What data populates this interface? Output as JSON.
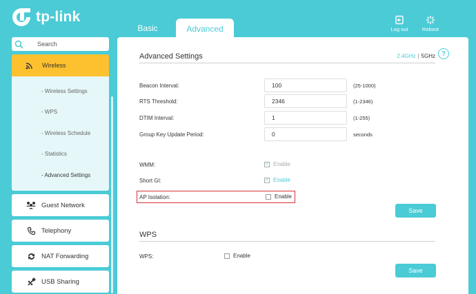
{
  "header": {
    "brand": "tp-link",
    "tabs": [
      {
        "label": "Basic",
        "active": false
      },
      {
        "label": "Advanced",
        "active": true
      }
    ],
    "logout_label": "Log out",
    "reboot_label": "Reboot"
  },
  "sidebar": {
    "search_placeholder": "Search",
    "active_item": {
      "label": "Wireless",
      "icon": "wifi-icon"
    },
    "sub_items": [
      {
        "label": "- Wireless Settings"
      },
      {
        "label": "- WPS"
      },
      {
        "label": "- Wireless Schedule"
      },
      {
        "label": "- Statistics"
      },
      {
        "label": "- Advanced Settings"
      }
    ],
    "items": [
      {
        "label": "Guest Network",
        "icon": "guest-users-icon"
      },
      {
        "label": "Telephony",
        "icon": "phone-icon"
      },
      {
        "label": "NAT Forwarding",
        "icon": "nat-icon"
      },
      {
        "label": "USB Sharing",
        "icon": "usb-icon"
      }
    ]
  },
  "advanced": {
    "title": "Advanced Settings",
    "band_24": "2.4GHz",
    "band_sep": "|",
    "band_5": "5GHz",
    "fields": [
      {
        "label": "Beacon Interval:",
        "value": "100",
        "hint": "(25-1000)"
      },
      {
        "label": "RTS Threshold:",
        "value": "2346",
        "hint": "(1-2346)"
      },
      {
        "label": "DTIM Interval:",
        "value": "1",
        "hint": "(1-255)"
      },
      {
        "label": "Group Key Update Period:",
        "value": "0",
        "hint": "seconds"
      }
    ],
    "wmm": {
      "label": "WMM:",
      "option": "Enable",
      "checked": true,
      "disabled": true
    },
    "short_gi": {
      "label": "Short GI:",
      "option": "Enable",
      "checked": true
    },
    "ap_isolation": {
      "label": "AP Isolation:",
      "option": "Enable",
      "checked": false
    },
    "save_label": "Save"
  },
  "wps": {
    "title": "WPS",
    "label": "WPS:",
    "option": "Enable",
    "checked": false,
    "save_label": "Save"
  },
  "colors": {
    "accent": "#4acbd6",
    "active": "#fdc12f",
    "highlight": "#d63030"
  }
}
